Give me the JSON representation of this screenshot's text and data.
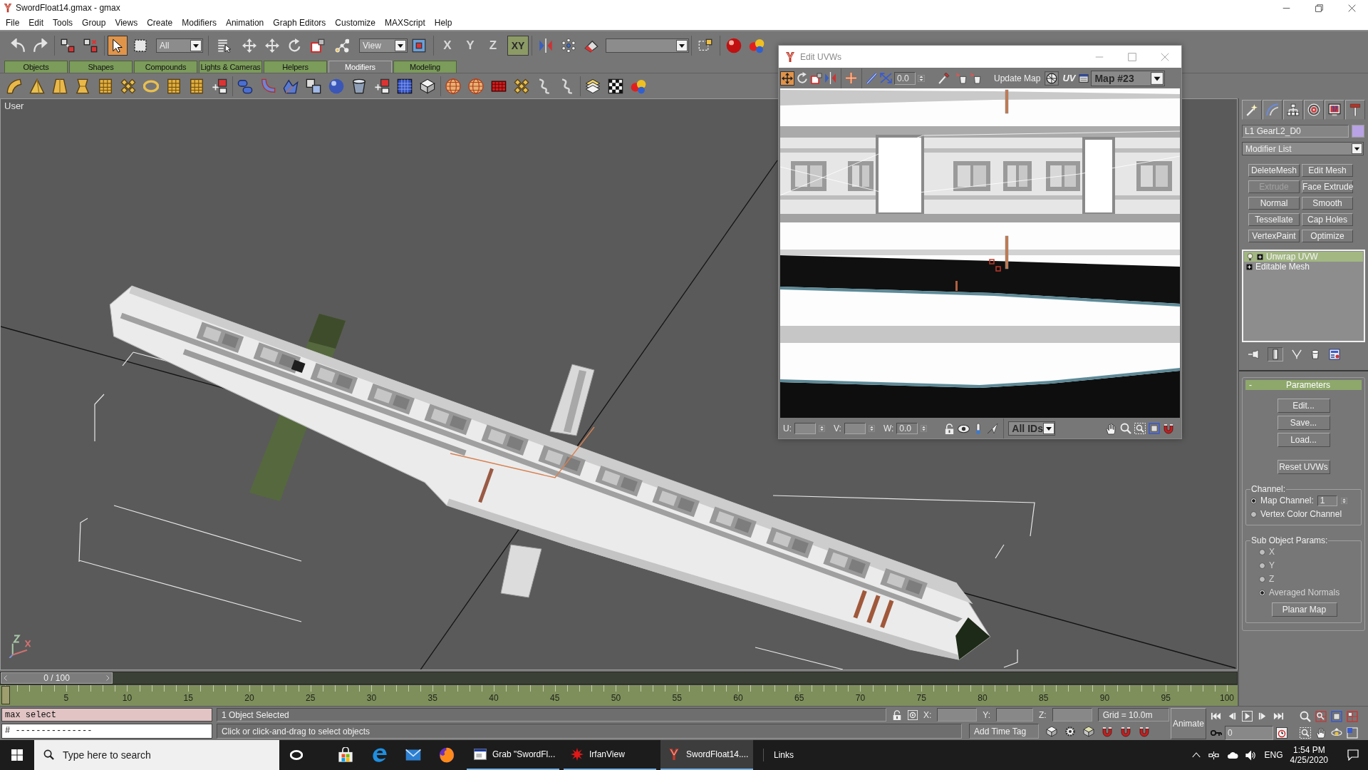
{
  "window": {
    "title": "SwordFloat14.gmax - gmax"
  },
  "menu": [
    "File",
    "Edit",
    "Tools",
    "Group",
    "Views",
    "Create",
    "Modifiers",
    "Animation",
    "Graph Editors",
    "Customize",
    "MAXScript",
    "Help"
  ],
  "main_toolbar": {
    "select_object": {
      "selected": true
    },
    "selection_filter": "All",
    "reference_coordinates": "View",
    "axis_constraints": [
      {
        "label": "X",
        "selected": false
      },
      {
        "label": "Y",
        "selected": false
      },
      {
        "label": "Z",
        "selected": false
      },
      {
        "label": "XY",
        "selected": true
      }
    ]
  },
  "tabs": [
    {
      "label": "Objects",
      "selected": false
    },
    {
      "label": "Shapes",
      "selected": false
    },
    {
      "label": "Compounds",
      "selected": false
    },
    {
      "label": "Lights & Cameras",
      "selected": false
    },
    {
      "label": "Helpers",
      "selected": false
    },
    {
      "label": "Modifiers",
      "selected": true
    },
    {
      "label": "Modeling",
      "selected": false
    }
  ],
  "viewport": {
    "label": "User"
  },
  "uv_editor": {
    "title": "Edit UVWs",
    "toolbar": {
      "move_tool": {
        "selected": true
      },
      "spinner_value": "0.0",
      "update_button": "Update Map",
      "uv_button": "UV",
      "map_dropdown": "Map #23"
    },
    "footer": {
      "u_label": "U:",
      "v_label": "V:",
      "w_label": "W:",
      "w_value": "0.0",
      "id_filter": "All IDs"
    }
  },
  "command_panel": {
    "object_name": "L1 GearL2_D0",
    "modifier_list": "Modifier List",
    "modifier_buttons": [
      {
        "label": "DeleteMesh",
        "disabled": false
      },
      {
        "label": "Edit Mesh",
        "disabled": false
      },
      {
        "label": "Extrude",
        "disabled": true
      },
      {
        "label": "Face Extrude",
        "disabled": false
      },
      {
        "label": "Normal",
        "disabled": false
      },
      {
        "label": "Smooth",
        "disabled": false
      },
      {
        "label": "Tessellate",
        "disabled": false
      },
      {
        "label": "Cap Holes",
        "disabled": false
      },
      {
        "label": "VertexPaint",
        "disabled": false
      },
      {
        "label": "Optimize",
        "disabled": false
      }
    ],
    "modifier_stack": [
      {
        "label": "Unwrap UVW",
        "kind": "modifier",
        "selected": true
      },
      {
        "label": "Editable Mesh",
        "kind": "base_object",
        "selected": false
      }
    ],
    "parameters": {
      "title": "Parameters",
      "collapse_sign": "-",
      "buttons": [
        "Edit...",
        "Save...",
        "Load..."
      ],
      "reset_button": "Reset UVWs",
      "channel": {
        "title": "Channel:",
        "options": [
          {
            "label": "Map Channel:",
            "selected": true
          },
          {
            "label": "Vertex Color Channel",
            "selected": false
          }
        ],
        "map_channel_value": "1"
      },
      "sub_object_params": {
        "title": "Sub Object Params:",
        "options": [
          {
            "label": "X",
            "selected": false
          },
          {
            "label": "Y",
            "selected": false
          },
          {
            "label": "Z",
            "selected": false
          },
          {
            "label": "Averaged Normals",
            "selected": true
          }
        ],
        "planar_map_button": "Planar Map"
      }
    }
  },
  "time_slider": {
    "label": "0 / 100",
    "level": 0
  },
  "track_bar": {
    "ticks": [
      "5",
      "10",
      "15",
      "20",
      "25",
      "30",
      "35",
      "40",
      "45",
      "50",
      "55",
      "60",
      "65",
      "70",
      "75",
      "80",
      "85",
      "90",
      "95",
      "100"
    ]
  },
  "listener": {
    "macro_recorder": "max select",
    "input": "# ---------------"
  },
  "status_bar": {
    "selection": "1 Object Selected",
    "prompt": "Click or click-and-drag to select objects",
    "x_label": "X:",
    "y_label": "Y:",
    "z_label": "Z:",
    "grid": "Grid = 10.0m",
    "time_tag_button": "Add Time Tag",
    "animate_button": "Animate",
    "frame_value": "0"
  },
  "taskbar": {
    "search_placeholder": "Type here to search",
    "apps": [
      {
        "label": "Grab \"SwordFl...",
        "kind": "grab",
        "selected": false
      },
      {
        "label": "IrfanView",
        "kind": "irfanview",
        "selected": false
      },
      {
        "label": "SwordFloat14....",
        "kind": "gmax",
        "selected": true
      }
    ],
    "toolbar_label": "Links",
    "language": "ENG",
    "time": "1:54 PM",
    "date": "4/25/2020"
  }
}
